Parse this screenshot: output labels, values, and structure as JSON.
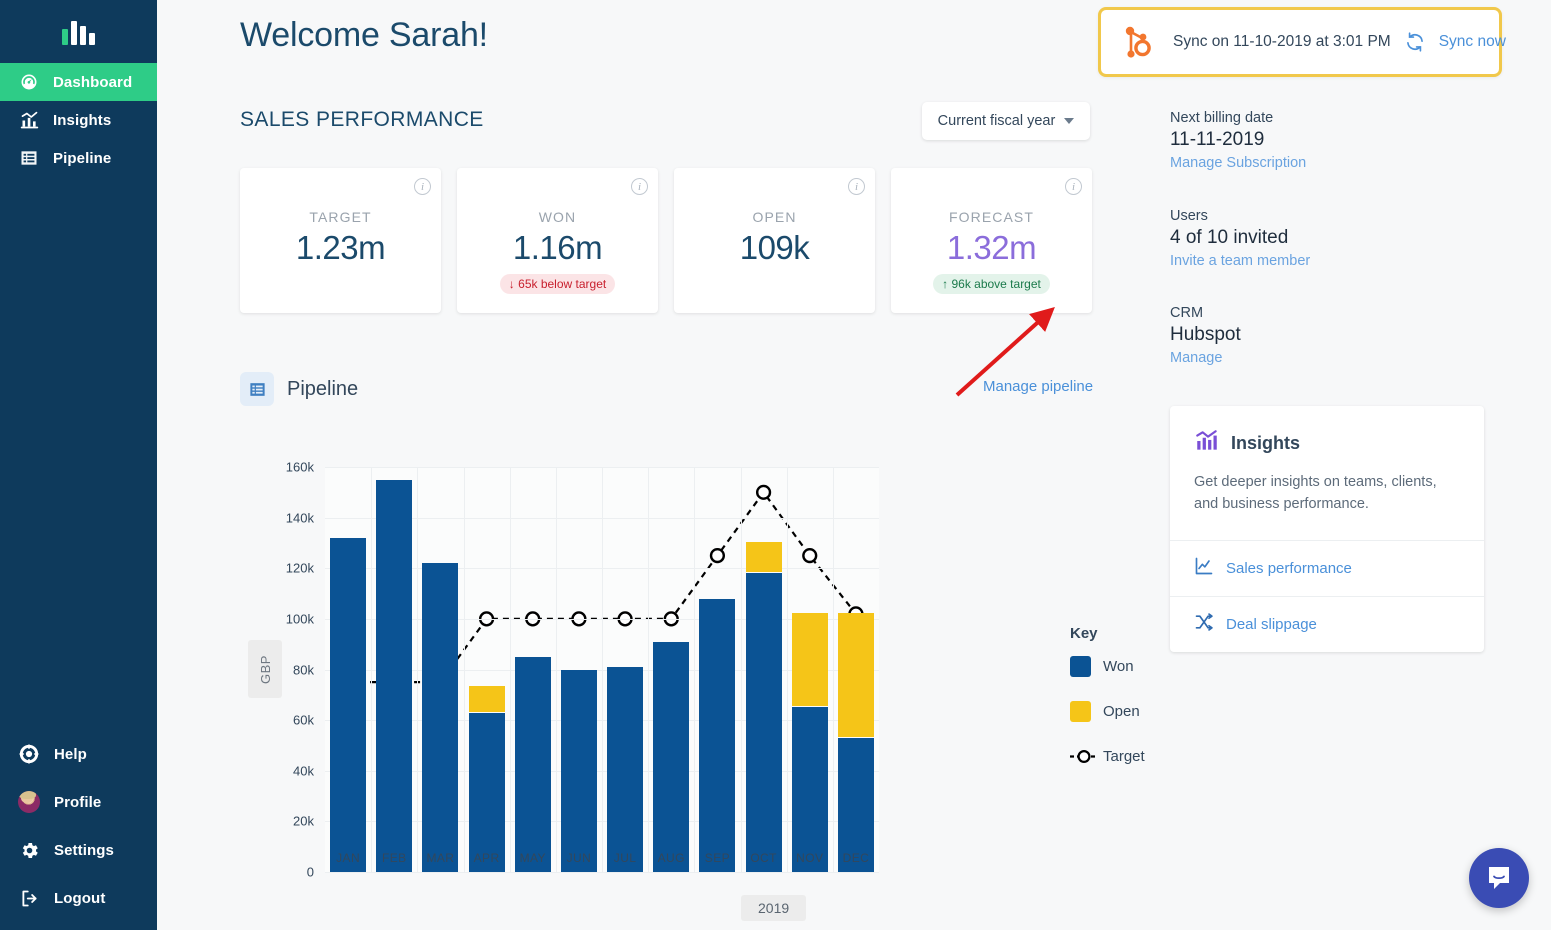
{
  "sidebar": {
    "logo_name": "logo-bars-icon",
    "items": [
      {
        "label": "Dashboard",
        "icon": "speedometer-icon",
        "active": true
      },
      {
        "label": "Insights",
        "icon": "bar-chart-up-icon",
        "active": false
      },
      {
        "label": "Pipeline",
        "icon": "list-box-icon",
        "active": false
      }
    ],
    "bottom_items": [
      {
        "label": "Help",
        "icon": "lifebuoy-icon"
      },
      {
        "label": "Profile",
        "icon": "avatar-icon"
      },
      {
        "label": "Settings",
        "icon": "gear-icon"
      },
      {
        "label": "Logout",
        "icon": "logout-icon"
      }
    ]
  },
  "header": {
    "welcome": "Welcome Sarah!"
  },
  "sync_banner": {
    "crm_logo": "hubspot-sprocket-icon",
    "text": "Sync on 11-10-2019 at 3:01 PM",
    "refresh_icon": "refresh-icon",
    "action_label": "Sync now",
    "border_color": "#f1c84b"
  },
  "sales_performance": {
    "title": "SALES PERFORMANCE",
    "period_select": {
      "value": "Current fiscal year",
      "icon": "chevron-down-icon"
    },
    "cards": [
      {
        "label": "TARGET",
        "value": "1.23m",
        "badge": null,
        "badge_type": null,
        "value_color": "#1b4a6b",
        "info_icon": "info-icon"
      },
      {
        "label": "WON",
        "value": "1.16m",
        "badge": "65k below target",
        "badge_type": "below",
        "badge_arrow": "↓",
        "value_color": "#1b4a6b",
        "info_icon": "info-icon"
      },
      {
        "label": "OPEN",
        "value": "109k",
        "badge": null,
        "badge_type": null,
        "value_color": "#1b4a6b",
        "info_icon": "info-icon"
      },
      {
        "label": "FORECAST",
        "value": "1.32m",
        "badge": "96k above target",
        "badge_type": "above",
        "badge_arrow": "↑",
        "value_color": "#8b6ddb",
        "info_icon": "info-icon"
      }
    ]
  },
  "pipeline": {
    "icon": "list-box-icon",
    "title": "Pipeline",
    "manage_link": "Manage pipeline",
    "year_label": "2019"
  },
  "chart_data": {
    "type": "bar",
    "title": "Pipeline",
    "xlabel": "2019",
    "ylabel": "GBP",
    "ylim": [
      0,
      160000
    ],
    "grid": true,
    "legend_position": "right",
    "legend_title": "Key",
    "ytick_labels": [
      "160k",
      "140k",
      "120k",
      "100k",
      "80k",
      "60k",
      "40k",
      "20k",
      "0"
    ],
    "ytick_values": [
      160000,
      140000,
      120000,
      100000,
      80000,
      60000,
      40000,
      20000,
      0
    ],
    "categories": [
      "JAN",
      "FEB",
      "MAR",
      "APR",
      "MAY",
      "JUN",
      "JUL",
      "AUG",
      "SEP",
      "OCT",
      "NOV",
      "DEC"
    ],
    "series": [
      {
        "name": "Won",
        "type": "bar",
        "color": "#0b5394",
        "stacked": true,
        "values": [
          132000,
          155000,
          122000,
          63000,
          85000,
          80000,
          81000,
          91000,
          108000,
          118000,
          65000,
          53000
        ]
      },
      {
        "name": "Open",
        "type": "bar",
        "color": "#f5c518",
        "stacked": true,
        "values": [
          0,
          0,
          0,
          10000,
          0,
          0,
          0,
          0,
          0,
          12000,
          37000,
          49000
        ]
      },
      {
        "name": "Target",
        "type": "line",
        "color": "#000000",
        "style": "dashed",
        "marker": "open-circle",
        "values": [
          75000,
          75000,
          75000,
          100000,
          100000,
          100000,
          100000,
          100000,
          125000,
          150000,
          125000,
          102000
        ]
      }
    ]
  },
  "account": {
    "billing": {
      "label": "Next billing date",
      "value": "11-11-2019",
      "link": "Manage Subscription"
    },
    "users": {
      "label": "Users",
      "value": "4 of 10 invited",
      "link": "Invite a team member"
    },
    "crm": {
      "label": "CRM",
      "value": "Hubspot",
      "link": "Manage"
    }
  },
  "insights_card": {
    "icon": "bar-chart-up-icon",
    "title": "Insights",
    "description": "Get deeper insights on teams, clients, and business performance.",
    "links": [
      {
        "label": "Sales performance",
        "icon": "line-chart-icon"
      },
      {
        "label": "Deal slippage",
        "icon": "shuffle-icon"
      }
    ]
  },
  "chat": {
    "icon": "chat-bubble-icon",
    "color": "#3a4cb4"
  }
}
